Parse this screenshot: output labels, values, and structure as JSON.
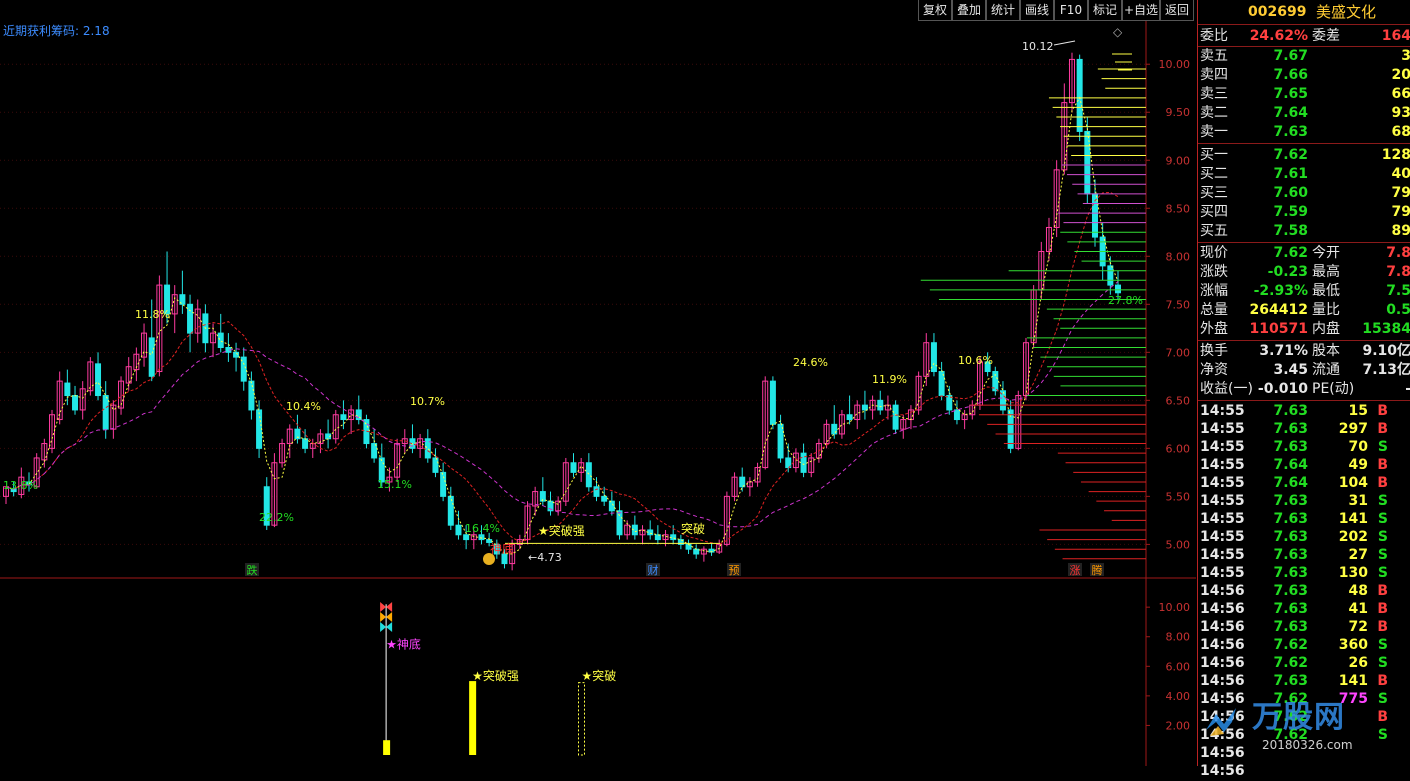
{
  "toolbar": {
    "buttons": [
      "复权",
      "叠加",
      "统计",
      "画线",
      "F10",
      "标记",
      "+自选",
      "返回"
    ]
  },
  "indicator_title": "近期获利筹码: 2.18",
  "stock": {
    "code": "002699",
    "name": "美盛文化"
  },
  "order_ratio": {
    "label1": "委比",
    "value1": "24.62%",
    "label2": "委差",
    "value2": "164"
  },
  "asks": [
    {
      "label": "卖五",
      "price": "7.67",
      "vol": "3"
    },
    {
      "label": "卖四",
      "price": "7.66",
      "vol": "20"
    },
    {
      "label": "卖三",
      "price": "7.65",
      "vol": "66"
    },
    {
      "label": "卖二",
      "price": "7.64",
      "vol": "93"
    },
    {
      "label": "卖一",
      "price": "7.63",
      "vol": "68"
    }
  ],
  "bids": [
    {
      "label": "买一",
      "price": "7.62",
      "vol": "128"
    },
    {
      "label": "买二",
      "price": "7.61",
      "vol": "40"
    },
    {
      "label": "买三",
      "price": "7.60",
      "vol": "79"
    },
    {
      "label": "买四",
      "price": "7.59",
      "vol": "79"
    },
    {
      "label": "买五",
      "price": "7.58",
      "vol": "89"
    }
  ],
  "quote": [
    {
      "l1": "现价",
      "v1": "7.62",
      "c1": "#22dd22",
      "l2": "今开",
      "v2": "7.8",
      "c2": "#ff4040"
    },
    {
      "l1": "涨跌",
      "v1": "-0.23",
      "c1": "#22dd22",
      "l2": "最高",
      "v2": "7.8",
      "c2": "#ff4040"
    },
    {
      "l1": "涨幅",
      "v1": "-2.93%",
      "c1": "#22dd22",
      "l2": "最低",
      "v2": "7.5",
      "c2": "#22dd22"
    },
    {
      "l1": "总量",
      "v1": "264412",
      "c1": "#ffff44",
      "l2": "量比",
      "v2": "0.5",
      "c2": "#22dd22"
    },
    {
      "l1": "外盘",
      "v1": "110571",
      "c1": "#ff4040",
      "l2": "内盘",
      "v2": "15384",
      "c2": "#22dd22"
    }
  ],
  "finance": [
    {
      "l1": "换手",
      "v1": "3.71%",
      "l2": "股本",
      "v2": "9.10亿"
    },
    {
      "l1": "净资",
      "v1": "3.45",
      "l2": "流通",
      "v2": "7.13亿"
    },
    {
      "l1": "收益(一)",
      "v1": "-0.010",
      "l2": "PE(动)",
      "v2": "-"
    }
  ],
  "ticks": [
    {
      "t": "14:55",
      "p": "7.63",
      "v": "15",
      "s": "B"
    },
    {
      "t": "14:55",
      "p": "7.63",
      "v": "297",
      "s": "B"
    },
    {
      "t": "14:55",
      "p": "7.63",
      "v": "70",
      "s": "S"
    },
    {
      "t": "14:55",
      "p": "7.64",
      "v": "49",
      "s": "B"
    },
    {
      "t": "14:55",
      "p": "7.64",
      "v": "104",
      "s": "B"
    },
    {
      "t": "14:55",
      "p": "7.63",
      "v": "31",
      "s": "S"
    },
    {
      "t": "14:55",
      "p": "7.63",
      "v": "141",
      "s": "S"
    },
    {
      "t": "14:55",
      "p": "7.63",
      "v": "202",
      "s": "S"
    },
    {
      "t": "14:55",
      "p": "7.63",
      "v": "27",
      "s": "S"
    },
    {
      "t": "14:55",
      "p": "7.63",
      "v": "130",
      "s": "S"
    },
    {
      "t": "14:56",
      "p": "7.63",
      "v": "48",
      "s": "B"
    },
    {
      "t": "14:56",
      "p": "7.63",
      "v": "41",
      "s": "B"
    },
    {
      "t": "14:56",
      "p": "7.63",
      "v": "72",
      "s": "B"
    },
    {
      "t": "14:56",
      "p": "7.62",
      "v": "360",
      "s": "S"
    },
    {
      "t": "14:56",
      "p": "7.62",
      "v": "26",
      "s": "S"
    },
    {
      "t": "14:56",
      "p": "7.63",
      "v": "141",
      "s": "B"
    },
    {
      "t": "14:56",
      "p": "7.62",
      "v": "775",
      "s": "S"
    },
    {
      "t": "14:56",
      "p": "7.62",
      "v": "",
      "s": "B"
    },
    {
      "t": "14:56",
      "p": "7.62",
      "v": "",
      "s": "S"
    },
    {
      "t": "14:56",
      "p": "",
      "v": "",
      "s": ""
    },
    {
      "t": "14:56",
      "p": "",
      "v": "",
      "s": ""
    }
  ],
  "price_axis": {
    "ticks": [
      "10.00",
      "9.50",
      "9.00",
      "8.50",
      "8.00",
      "7.50",
      "7.00",
      "6.50",
      "6.00",
      "5.50",
      "5.00"
    ],
    "range": [
      4.65,
      10.45
    ]
  },
  "sub_axis": {
    "ticks": [
      "10.00",
      "8.00",
      "6.00",
      "4.00",
      "2.00"
    ],
    "range": [
      0,
      11.5
    ]
  },
  "annotations": {
    "high_label": "10.12",
    "low_label": "4.73",
    "pcts": [
      "13.8%",
      "11.8%",
      "22.2%",
      "10.4%",
      "15.1%",
      "10.7%",
      "16.4%",
      "24.6%",
      "11.9%",
      "10.6%",
      "27.8%"
    ],
    "signals": [
      "神底",
      "突破强",
      "突破"
    ],
    "markers": [
      "跌",
      "财",
      "预",
      "涨",
      "腾"
    ]
  },
  "chart_data": {
    "type": "candlestick",
    "colors": {
      "up": "#ff3ba0",
      "down": "#22e6e6",
      "ma1": "#ffff44",
      "ma2": "#dd2222",
      "ma3": "#cc33cc"
    },
    "candles": [
      [
        5.5,
        5.6,
        5.42,
        5.6
      ],
      [
        5.58,
        5.65,
        5.5,
        5.55
      ],
      [
        5.52,
        5.8,
        5.48,
        5.7
      ],
      [
        5.65,
        5.75,
        5.55,
        5.62
      ],
      [
        5.6,
        5.95,
        5.58,
        5.9
      ],
      [
        5.88,
        6.1,
        5.8,
        6.05
      ],
      [
        6.0,
        6.4,
        5.95,
        6.35
      ],
      [
        6.3,
        6.8,
        6.25,
        6.7
      ],
      [
        6.68,
        6.82,
        6.45,
        6.55
      ],
      [
        6.55,
        6.65,
        6.35,
        6.4
      ],
      [
        6.4,
        6.7,
        6.3,
        6.62
      ],
      [
        6.6,
        6.95,
        6.55,
        6.9
      ],
      [
        6.88,
        7.0,
        6.5,
        6.55
      ],
      [
        6.55,
        6.7,
        6.1,
        6.2
      ],
      [
        6.2,
        6.5,
        6.1,
        6.45
      ],
      [
        6.42,
        6.75,
        6.35,
        6.7
      ],
      [
        6.68,
        6.95,
        6.6,
        6.85
      ],
      [
        6.82,
        7.05,
        6.7,
        6.98
      ],
      [
        6.95,
        7.3,
        6.85,
        7.2
      ],
      [
        7.15,
        7.55,
        6.7,
        6.75
      ],
      [
        6.8,
        7.8,
        6.75,
        7.7
      ],
      [
        7.7,
        8.05,
        7.3,
        7.4
      ],
      [
        7.4,
        7.7,
        7.2,
        7.6
      ],
      [
        7.6,
        7.85,
        7.4,
        7.5
      ],
      [
        7.5,
        7.6,
        7.0,
        7.2
      ],
      [
        7.2,
        7.55,
        7.1,
        7.45
      ],
      [
        7.4,
        7.5,
        7.0,
        7.1
      ],
      [
        7.1,
        7.3,
        6.95,
        7.2
      ],
      [
        7.2,
        7.4,
        7.0,
        7.05
      ],
      [
        7.05,
        7.2,
        6.9,
        7.0
      ],
      [
        7.0,
        7.1,
        6.8,
        6.95
      ],
      [
        6.95,
        7.05,
        6.6,
        6.7
      ],
      [
        6.7,
        6.8,
        6.3,
        6.4
      ],
      [
        6.4,
        6.5,
        5.9,
        6.0
      ],
      [
        5.6,
        5.7,
        5.15,
        5.2
      ],
      [
        5.2,
        5.95,
        5.18,
        5.85
      ],
      [
        5.85,
        6.1,
        5.8,
        6.05
      ],
      [
        6.05,
        6.25,
        5.9,
        6.2
      ],
      [
        6.2,
        6.35,
        6.05,
        6.1
      ],
      [
        6.1,
        6.2,
        5.95,
        6.0
      ],
      [
        6.0,
        6.1,
        5.9,
        6.05
      ],
      [
        6.05,
        6.2,
        5.95,
        6.15
      ],
      [
        6.15,
        6.3,
        6.0,
        6.1
      ],
      [
        6.1,
        6.4,
        6.05,
        6.35
      ],
      [
        6.35,
        6.5,
        6.2,
        6.3
      ],
      [
        6.3,
        6.45,
        6.15,
        6.4
      ],
      [
        6.4,
        6.55,
        6.25,
        6.3
      ],
      [
        6.3,
        6.35,
        6.0,
        6.05
      ],
      [
        6.05,
        6.2,
        5.85,
        5.9
      ],
      [
        5.9,
        6.05,
        5.6,
        5.65
      ],
      [
        5.65,
        5.8,
        5.55,
        5.7
      ],
      [
        5.7,
        6.1,
        5.65,
        6.05
      ],
      [
        6.05,
        6.2,
        5.95,
        6.1
      ],
      [
        6.1,
        6.25,
        5.95,
        6.0
      ],
      [
        6.0,
        6.15,
        5.9,
        6.1
      ],
      [
        6.1,
        6.2,
        5.85,
        5.9
      ],
      [
        5.9,
        6.0,
        5.7,
        5.75
      ],
      [
        5.75,
        5.85,
        5.45,
        5.5
      ],
      [
        5.5,
        5.6,
        5.15,
        5.2
      ],
      [
        5.2,
        5.35,
        5.05,
        5.1
      ],
      [
        5.1,
        5.2,
        4.95,
        5.05
      ],
      [
        5.05,
        5.15,
        4.95,
        5.1
      ],
      [
        5.1,
        5.2,
        5.0,
        5.05
      ],
      [
        5.05,
        5.12,
        4.98,
        5.02
      ],
      [
        5.0,
        5.05,
        4.85,
        4.9
      ],
      [
        4.9,
        4.95,
        4.75,
        4.8
      ],
      [
        4.8,
        5.05,
        4.73,
        5.0
      ],
      [
        5.0,
        5.1,
        4.95,
        5.05
      ],
      [
        5.05,
        5.45,
        5.0,
        5.4
      ],
      [
        5.4,
        5.6,
        5.3,
        5.55
      ],
      [
        5.55,
        5.7,
        5.4,
        5.45
      ],
      [
        5.45,
        5.55,
        5.3,
        5.35
      ],
      [
        5.35,
        5.5,
        5.3,
        5.45
      ],
      [
        5.45,
        5.9,
        5.4,
        5.85
      ],
      [
        5.85,
        5.95,
        5.7,
        5.75
      ],
      [
        5.75,
        5.9,
        5.65,
        5.85
      ],
      [
        5.85,
        5.95,
        5.55,
        5.6
      ],
      [
        5.6,
        5.7,
        5.45,
        5.5
      ],
      [
        5.5,
        5.6,
        5.4,
        5.45
      ],
      [
        5.45,
        5.55,
        5.3,
        5.35
      ],
      [
        5.35,
        5.45,
        5.05,
        5.1
      ],
      [
        5.1,
        5.25,
        5.05,
        5.2
      ],
      [
        5.2,
        5.3,
        5.05,
        5.1
      ],
      [
        5.1,
        5.2,
        5.0,
        5.15
      ],
      [
        5.15,
        5.25,
        5.05,
        5.1
      ],
      [
        5.1,
        5.2,
        5.0,
        5.05
      ],
      [
        5.05,
        5.15,
        4.98,
        5.1
      ],
      [
        5.1,
        5.2,
        5.0,
        5.05
      ],
      [
        5.05,
        5.1,
        4.95,
        5.0
      ],
      [
        5.0,
        5.05,
        4.9,
        4.95
      ],
      [
        4.95,
        5.0,
        4.85,
        4.9
      ],
      [
        4.9,
        4.98,
        4.82,
        4.95
      ],
      [
        4.95,
        5.02,
        4.88,
        4.92
      ],
      [
        4.92,
        5.05,
        4.9,
        5.0
      ],
      [
        5.0,
        5.55,
        4.98,
        5.5
      ],
      [
        5.5,
        5.75,
        5.45,
        5.7
      ],
      [
        5.7,
        5.8,
        5.55,
        5.6
      ],
      [
        5.6,
        5.7,
        5.5,
        5.65
      ],
      [
        5.65,
        5.85,
        5.6,
        5.8
      ],
      [
        5.8,
        6.75,
        5.78,
        6.7
      ],
      [
        6.7,
        6.75,
        6.2,
        6.25
      ],
      [
        6.25,
        6.35,
        5.85,
        5.9
      ],
      [
        5.9,
        6.05,
        5.75,
        5.8
      ],
      [
        5.8,
        6.0,
        5.75,
        5.95
      ],
      [
        5.95,
        6.05,
        5.7,
        5.75
      ],
      [
        5.75,
        5.95,
        5.7,
        5.9
      ],
      [
        5.9,
        6.1,
        5.85,
        6.05
      ],
      [
        6.05,
        6.3,
        6.0,
        6.25
      ],
      [
        6.25,
        6.45,
        6.1,
        6.15
      ],
      [
        6.15,
        6.4,
        6.1,
        6.35
      ],
      [
        6.35,
        6.55,
        6.25,
        6.3
      ],
      [
        6.3,
        6.5,
        6.2,
        6.45
      ],
      [
        6.45,
        6.6,
        6.3,
        6.4
      ],
      [
        6.4,
        6.55,
        6.3,
        6.5
      ],
      [
        6.5,
        6.6,
        6.35,
        6.4
      ],
      [
        6.4,
        6.55,
        6.3,
        6.45
      ],
      [
        6.45,
        6.5,
        6.15,
        6.2
      ],
      [
        6.2,
        6.35,
        6.1,
        6.3
      ],
      [
        6.3,
        6.45,
        6.2,
        6.4
      ],
      [
        6.4,
        6.8,
        6.35,
        6.75
      ],
      [
        6.75,
        7.2,
        6.65,
        7.1
      ],
      [
        7.1,
        7.2,
        6.75,
        6.8
      ],
      [
        6.8,
        6.9,
        6.5,
        6.55
      ],
      [
        6.55,
        6.65,
        6.35,
        6.4
      ],
      [
        6.4,
        6.5,
        6.25,
        6.3
      ],
      [
        6.3,
        6.4,
        6.2,
        6.35
      ],
      [
        6.35,
        6.5,
        6.3,
        6.45
      ],
      [
        6.45,
        6.95,
        6.4,
        6.9
      ],
      [
        6.9,
        7.0,
        6.75,
        6.8
      ],
      [
        6.8,
        6.85,
        6.55,
        6.6
      ],
      [
        6.6,
        6.7,
        6.35,
        6.4
      ],
      [
        6.4,
        6.5,
        5.95,
        6.0
      ],
      [
        6.0,
        6.6,
        5.98,
        6.55
      ],
      [
        6.55,
        7.15,
        6.5,
        7.1
      ],
      [
        7.1,
        7.7,
        7.05,
        7.65
      ],
      [
        7.65,
        8.15,
        7.55,
        8.05
      ],
      [
        8.05,
        8.4,
        7.95,
        8.3
      ],
      [
        8.3,
        9.0,
        8.2,
        8.9
      ],
      [
        8.9,
        9.8,
        8.85,
        9.6
      ],
      [
        9.6,
        10.12,
        9.5,
        10.05
      ],
      [
        10.05,
        10.1,
        9.2,
        9.3
      ],
      [
        9.3,
        9.45,
        8.55,
        8.65
      ],
      [
        8.65,
        8.8,
        8.1,
        8.2
      ],
      [
        8.2,
        8.35,
        7.75,
        7.9
      ],
      [
        7.9,
        8.0,
        7.6,
        7.7
      ],
      [
        7.7,
        7.85,
        7.55,
        7.62
      ]
    ],
    "volumes_signal": [
      {
        "idx": 48,
        "value": 1.0
      },
      {
        "idx": 60,
        "value": 5.0
      },
      {
        "idx": 74,
        "value": 4.9
      }
    ]
  }
}
